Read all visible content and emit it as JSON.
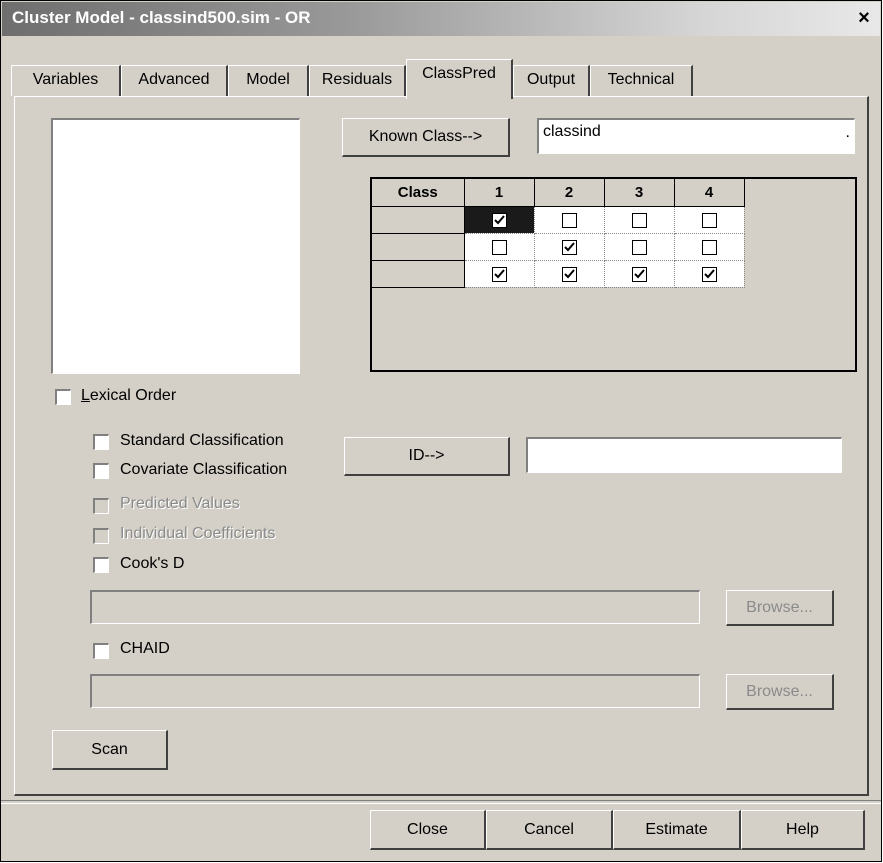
{
  "window": {
    "title": "Cluster Model - classind500.sim - OR",
    "close_glyph": "×"
  },
  "tabs": [
    "Variables",
    "Advanced",
    "Model",
    "Residuals",
    "ClassPred",
    "Output",
    "Technical"
  ],
  "active_tab": "ClassPred",
  "known_class": {
    "button": "Known Class-->",
    "value": "classind",
    "trailing_mark": "."
  },
  "class_grid": {
    "header": "Class",
    "columns": [
      "1",
      "2",
      "3",
      "4"
    ],
    "rows": [
      [
        true,
        false,
        false,
        false
      ],
      [
        false,
        true,
        false,
        false
      ],
      [
        true,
        true,
        true,
        true
      ]
    ]
  },
  "lexical_order": {
    "label": "Lexical Order",
    "checked": false
  },
  "id": {
    "button": "ID-->",
    "value": ""
  },
  "options": [
    {
      "label": "Standard Classification",
      "enabled": true,
      "checked": false
    },
    {
      "label": "Covariate Classification",
      "enabled": true,
      "checked": false
    },
    {
      "label": "Predicted Values",
      "enabled": false,
      "checked": false
    },
    {
      "label": "Individual Coefficients",
      "enabled": false,
      "checked": false
    },
    {
      "label": "Cook's D",
      "enabled": true,
      "checked": false
    }
  ],
  "browse_label": "Browse...",
  "chaid": {
    "label": "CHAID",
    "checked": false
  },
  "scan_label": "Scan",
  "footer_buttons": [
    "Close",
    "Cancel",
    "Estimate",
    "Help"
  ]
}
